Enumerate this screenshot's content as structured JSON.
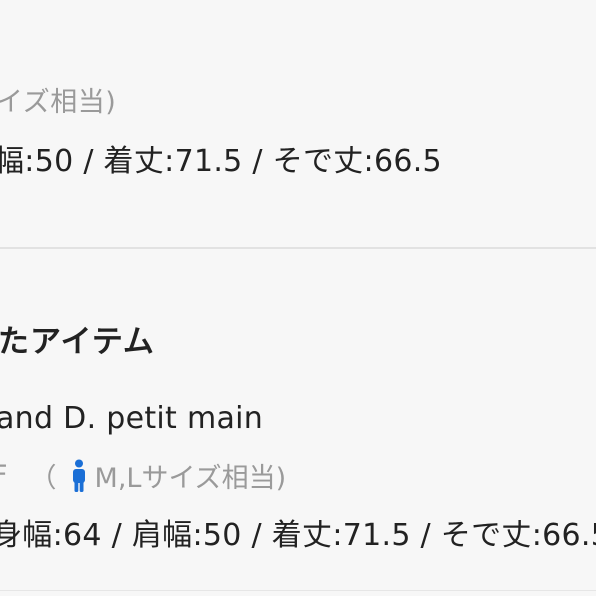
{
  "top_item": {
    "size_note": "イズ相当)",
    "measurements": "幅:50 / 着丈:71.5 / そで丈:66.5"
  },
  "related_section": {
    "heading": "たアイテム",
    "brand": "and D. petit main",
    "size_prefix": "F",
    "size_open_paren": "（",
    "size_icon": "person-icon",
    "size_label": "M,Lサイズ相当)",
    "measurements": "身幅:64 / 肩幅:50 / 着丈:71.5 / そで丈:66.5"
  },
  "colors": {
    "background": "#f7f7f7",
    "text": "#222222",
    "muted": "#9a9a9a",
    "icon": "#1b6fd6",
    "divider": "#e2e2e2"
  }
}
